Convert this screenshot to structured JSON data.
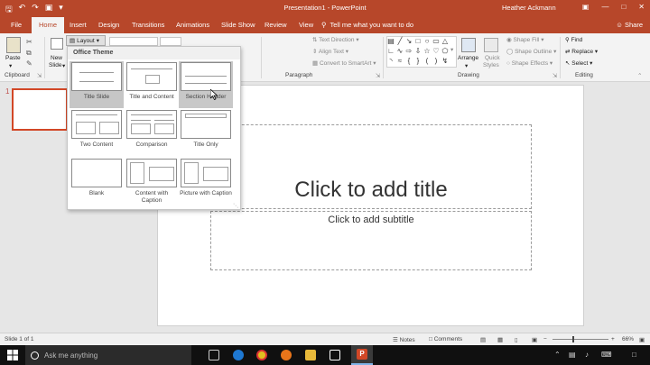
{
  "window": {
    "title": "Presentation1 - PowerPoint",
    "user": "Heather Ackmann",
    "colors": {
      "accent": "#b7472a",
      "selection": "#d24726"
    }
  },
  "tabs": [
    "File",
    "Home",
    "Insert",
    "Design",
    "Transitions",
    "Animations",
    "Slide Show",
    "Review",
    "View"
  ],
  "tell_me": "Tell me what you want to do",
  "share": "Share",
  "ribbon": {
    "clipboard": {
      "paste": "Paste",
      "label": "Clipboard"
    },
    "slides": {
      "new_slide_1": "New",
      "new_slide_2": "Slide",
      "layout": "Layout"
    },
    "paragraph": {
      "text_direction": "Text Direction",
      "align_text": "Align Text",
      "convert_smartart": "Convert to SmartArt",
      "label": "Paragraph"
    },
    "drawing": {
      "arrange": "Arrange",
      "quick_styles_1": "Quick",
      "quick_styles_2": "Styles",
      "shape_fill": "Shape Fill",
      "shape_outline": "Shape Outline",
      "shape_effects": "Shape Effects",
      "label": "Drawing"
    },
    "editing": {
      "find": "Find",
      "replace": "Replace",
      "select": "Select",
      "label": "Editing"
    }
  },
  "layout_gallery": {
    "heading": "Office Theme",
    "items": [
      {
        "name": "Title Slide",
        "state": "selected"
      },
      {
        "name": "Title and Content",
        "state": "normal"
      },
      {
        "name": "Section Header",
        "state": "hover"
      },
      {
        "name": "Two Content",
        "state": "normal"
      },
      {
        "name": "Comparison",
        "state": "normal"
      },
      {
        "name": "Title Only",
        "state": "normal"
      },
      {
        "name": "Blank",
        "state": "normal"
      },
      {
        "name": "Content with Caption",
        "state": "normal"
      },
      {
        "name": "Picture with Caption",
        "state": "normal"
      }
    ]
  },
  "slide_panel": {
    "number": "1"
  },
  "slide": {
    "title_placeholder": "Click to add title",
    "subtitle_placeholder": "Click to add subtitle"
  },
  "status": {
    "slide_count": "Slide 1 of 1",
    "notes": "Notes",
    "comments": "Comments",
    "zoom": "66%"
  },
  "taskbar": {
    "search_placeholder": "Ask me anything"
  }
}
